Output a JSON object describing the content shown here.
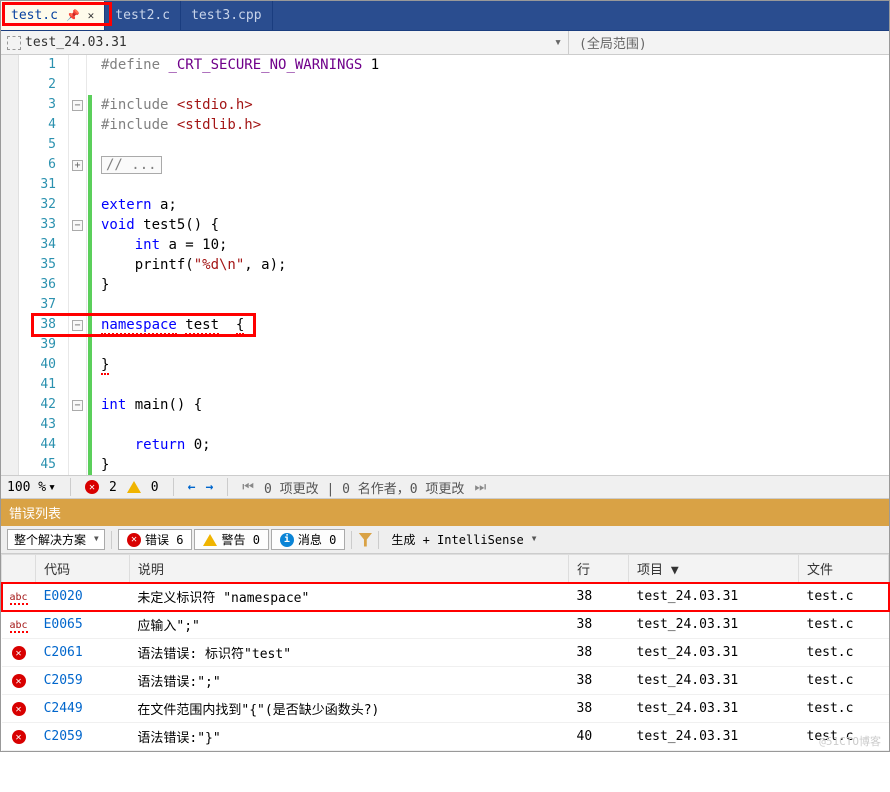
{
  "tabs": [
    {
      "name": "test.c",
      "active": true,
      "pinned": true
    },
    {
      "name": "test2.c",
      "active": false
    },
    {
      "name": "test3.cpp",
      "active": false
    }
  ],
  "nav": {
    "left": "test_24.03.31",
    "right": "(全局范围)"
  },
  "code": {
    "lines": [
      {
        "n": "1",
        "change": false,
        "fold": "",
        "html": "<span class='pp'>#define </span><span class='mac'>_CRT_SECURE_NO_WARNINGS</span> 1"
      },
      {
        "n": "2",
        "change": false,
        "fold": "",
        "html": ""
      },
      {
        "n": "3",
        "change": true,
        "fold": "-",
        "html": "<span class='pp'>#include </span><span class='str'>&lt;stdio.h&gt;</span>"
      },
      {
        "n": "4",
        "change": true,
        "fold": "",
        "html": "<span class='pp'>#include </span><span class='str'>&lt;stdlib.h&gt;</span>"
      },
      {
        "n": "5",
        "change": true,
        "fold": "",
        "html": ""
      },
      {
        "n": "6",
        "change": true,
        "fold": "+",
        "html": "<span class='collapsed-box'>// ...</span>"
      },
      {
        "n": "31",
        "change": true,
        "fold": "",
        "html": ""
      },
      {
        "n": "32",
        "change": true,
        "fold": "",
        "html": "<span class='kw'>extern</span> a;"
      },
      {
        "n": "33",
        "change": true,
        "fold": "-",
        "html": "<span class='kw'>void</span> test5() {"
      },
      {
        "n": "34",
        "change": true,
        "fold": "",
        "html": "    <span class='kw'>int</span> a = 10;"
      },
      {
        "n": "35",
        "change": true,
        "fold": "",
        "html": "    printf(<span class='str'>\"%d\\n\"</span>, a);"
      },
      {
        "n": "36",
        "change": true,
        "fold": "",
        "html": "}"
      },
      {
        "n": "37",
        "change": true,
        "fold": "",
        "html": ""
      },
      {
        "n": "38",
        "change": true,
        "fold": "-",
        "html": "<span class='kw squig'>namespace</span> <span class='squig'>test</span>  <span class='squig'>{</span>"
      },
      {
        "n": "39",
        "change": true,
        "fold": "",
        "html": ""
      },
      {
        "n": "40",
        "change": true,
        "fold": "",
        "html": "<span class='squig'>}</span>"
      },
      {
        "n": "41",
        "change": true,
        "fold": "",
        "html": ""
      },
      {
        "n": "42",
        "change": true,
        "fold": "-",
        "html": "<span class='kw'>int</span> main() {"
      },
      {
        "n": "43",
        "change": true,
        "fold": "",
        "html": ""
      },
      {
        "n": "44",
        "change": true,
        "fold": "",
        "html": "    <span class='kw'>return</span> 0;"
      },
      {
        "n": "45",
        "change": true,
        "fold": "",
        "html": "}"
      }
    ]
  },
  "status": {
    "zoom": "100 %",
    "errors": "2",
    "warnings": "0",
    "changes": "0 项更改 | 0 名作者，0 项更改"
  },
  "errlist": {
    "title": "错误列表",
    "scope": "整个解决方案",
    "btns": {
      "err": "错误 6",
      "warn": "警告 0",
      "info": "消息 0"
    },
    "build_dd": "生成 + IntelliSense",
    "cols": {
      "code": "代码",
      "desc": "说明",
      "line": "行",
      "project": "项目 ▼",
      "file": "文件"
    },
    "rows": [
      {
        "sev": "abc",
        "code": "E0020",
        "desc": "未定义标识符 \"namespace\"",
        "line": "38",
        "project": "test_24.03.31",
        "file": "test.c",
        "hl": true
      },
      {
        "sev": "abc",
        "code": "E0065",
        "desc": "应输入\";\"",
        "line": "38",
        "project": "test_24.03.31",
        "file": "test.c"
      },
      {
        "sev": "err",
        "code": "C2061",
        "desc": "语法错误: 标识符\"test\"",
        "line": "38",
        "project": "test_24.03.31",
        "file": "test.c"
      },
      {
        "sev": "err",
        "code": "C2059",
        "desc": "语法错误:\";\"",
        "line": "38",
        "project": "test_24.03.31",
        "file": "test.c"
      },
      {
        "sev": "err",
        "code": "C2449",
        "desc": "在文件范围内找到\"{\"(是否缺少函数头?)",
        "line": "38",
        "project": "test_24.03.31",
        "file": "test.c"
      },
      {
        "sev": "err",
        "code": "C2059",
        "desc": "语法错误:\"}\"",
        "line": "40",
        "project": "test_24.03.31",
        "file": "test.c"
      }
    ]
  },
  "watermark": "@51CTO博客"
}
